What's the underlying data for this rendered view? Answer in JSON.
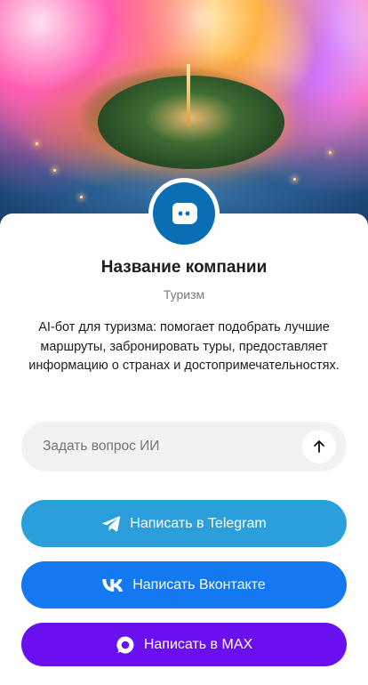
{
  "hero": {
    "icon": "city-fireworks-image"
  },
  "company": {
    "name": "Название компании",
    "category": "Туризм",
    "description": "AI-бот для туризма: помогает подобрать лучшие маршруты, забронировать туры, предоставляет информацию о странах и достопримечательностях."
  },
  "ask": {
    "placeholder": "Задать вопрос ИИ",
    "send_icon": "arrow-up-icon"
  },
  "buttons": {
    "telegram": {
      "label": "Написать в Telegram",
      "icon": "telegram-icon",
      "color": "#2a9fdc"
    },
    "vk": {
      "label": "Написать Вконтакте",
      "icon": "vk-icon",
      "color": "#1479f0"
    },
    "max": {
      "label": "Написать в MAX",
      "icon": "max-icon",
      "color": "#6a0ff0"
    }
  },
  "colors": {
    "avatar": "#0a6eb5",
    "input_bg": "#f2f2f4"
  }
}
